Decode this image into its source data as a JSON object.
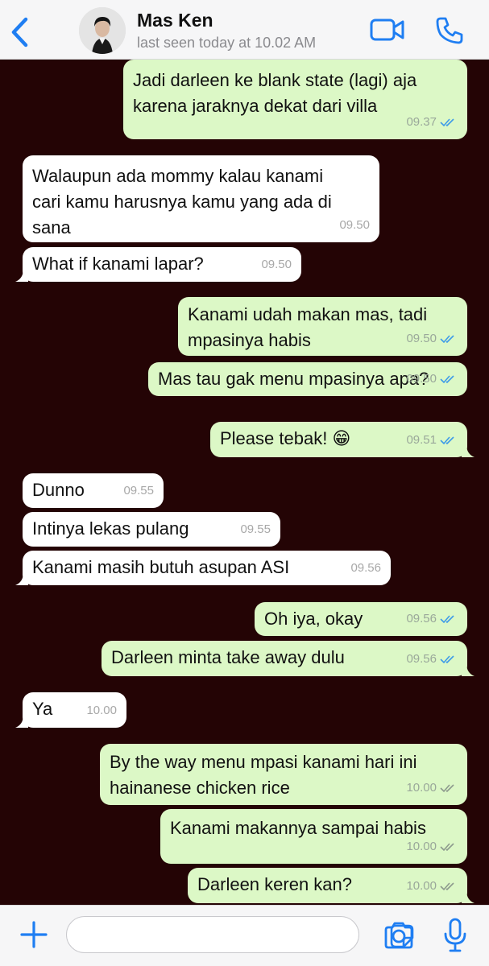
{
  "header": {
    "contact_name": "Mas Ken",
    "last_seen": "last seen today at 10.02 AM"
  },
  "colors": {
    "accent": "#1f7ef2",
    "chat_background": "#240405",
    "outgoing_bubble": "#dcf8c6",
    "incoming_bubble": "#ffffff",
    "read_ticks": "#3d9be9",
    "delivered_ticks": "#8d9a8d"
  },
  "messages": [
    {
      "direction": "out",
      "lines": [
        "Jadi darleen ke blank state (lagi) aja",
        "karena jaraknya dekat dari villa"
      ],
      "time": "09.37",
      "status": "read"
    },
    {
      "direction": "in",
      "lines": [
        "Walaupun ada mommy kalau kanami",
        "cari kamu harusnya kamu yang ada di",
        "sana"
      ],
      "time": "09.50"
    },
    {
      "direction": "in",
      "lines": [
        "What if kanami lapar?"
      ],
      "time": "09.50"
    },
    {
      "direction": "out",
      "lines": [
        "Kanami udah makan mas, tadi",
        "mpasinya habis"
      ],
      "time": "09.50",
      "status": "read"
    },
    {
      "direction": "out",
      "lines": [
        "Mas tau gak menu mpasinya apa?"
      ],
      "time": "09.50",
      "status": "read"
    },
    {
      "direction": "out",
      "lines": [
        "Please tebak! 😁"
      ],
      "time": "09.51",
      "status": "read"
    },
    {
      "direction": "in",
      "lines": [
        "Dunno"
      ],
      "time": "09.55"
    },
    {
      "direction": "in",
      "lines": [
        "Intinya lekas pulang"
      ],
      "time": "09.55"
    },
    {
      "direction": "in",
      "lines": [
        "Kanami masih butuh asupan ASI"
      ],
      "time": "09.56"
    },
    {
      "direction": "out",
      "lines": [
        "Oh iya, okay"
      ],
      "time": "09.56",
      "status": "read"
    },
    {
      "direction": "out",
      "lines": [
        "Darleen minta take away dulu"
      ],
      "time": "09.56",
      "status": "read"
    },
    {
      "direction": "in",
      "lines": [
        "Ya"
      ],
      "time": "10.00"
    },
    {
      "direction": "out",
      "lines": [
        "By the way menu mpasi kanami hari ini",
        "hainanese chicken rice"
      ],
      "time": "10.00",
      "status": "delivered"
    },
    {
      "direction": "out",
      "lines": [
        "Kanami makannya sampai habis"
      ],
      "time": "10.00",
      "status": "delivered"
    },
    {
      "direction": "out",
      "lines": [
        "Darleen keren kan?"
      ],
      "time": "10.00",
      "status": "delivered"
    }
  ],
  "input": {
    "value": "",
    "placeholder": ""
  },
  "icons": {
    "back": "chevron-left-icon",
    "video": "video-call-icon",
    "call": "phone-icon",
    "plus": "plus-icon",
    "sticker": "sticker-icon",
    "camera": "camera-icon",
    "mic": "microphone-icon"
  }
}
